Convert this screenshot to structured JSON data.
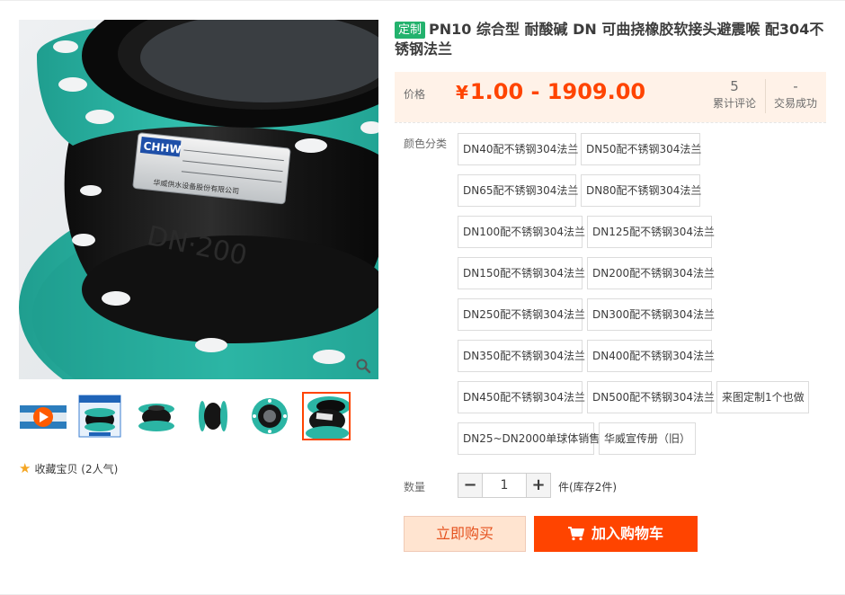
{
  "product": {
    "tag": "定制",
    "title": "PN10 综合型 耐酸碱 DN 可曲挠橡胶软接头避震喉 配304不锈钢法兰"
  },
  "gallery": {
    "main_image_brand": "CHHW",
    "main_image_plate_text": "华威供水设备股份有限公司",
    "main_image_mark": "DN·200",
    "thumbnails": [
      "video-thumb",
      "box-thumb",
      "joint-front-thumb",
      "joint-side-thumb",
      "flange-thumb",
      "closeup-thumb"
    ],
    "active_thumbnail": 5
  },
  "favorite": {
    "label": "收藏宝贝 (2人气)"
  },
  "price": {
    "label": "价格",
    "currency": "¥",
    "range": "1.00 - 1909.00",
    "reviews_count": "5",
    "reviews_label": "累计评论",
    "deals_count": "-",
    "deals_label": "交易成功"
  },
  "sku": {
    "label": "颜色分类",
    "options": [
      "DN40配不锈钢304法兰",
      "DN50配不锈钢304法兰",
      "DN65配不锈钢304法兰",
      "DN80配不锈钢304法兰",
      "DN100配不锈钢304法兰",
      "DN125配不锈钢304法兰",
      "DN150配不锈钢304法兰",
      "DN200配不锈钢304法兰",
      "DN250配不锈钢304法兰",
      "DN300配不锈钢304法兰",
      "DN350配不锈钢304法兰",
      "DN400配不锈钢304法兰",
      "DN450配不锈钢304法兰",
      "DN500配不锈钢304法兰",
      "来图定制1个也做",
      "DN25~DN2000单球体销售",
      "华威宣传册（旧）"
    ]
  },
  "quantity": {
    "label": "数量",
    "minus": "−",
    "value": "1",
    "plus": "+",
    "stock": "件(库存2件)"
  },
  "actions": {
    "buy_now": "立即购买",
    "add_to_cart": "加入购物车"
  },
  "colors": {
    "accent": "#ff4400",
    "tag_green": "#23b26d",
    "flange_teal": "#2bb5a4",
    "price_bg": "#fff2e8"
  }
}
